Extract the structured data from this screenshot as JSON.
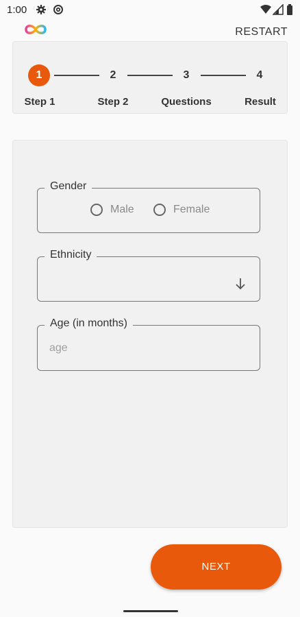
{
  "status_bar": {
    "time": "1:00"
  },
  "app_bar": {
    "restart_label": "RESTART"
  },
  "stepper": {
    "steps": [
      {
        "number": "1",
        "label": "Step 1",
        "active": true
      },
      {
        "number": "2",
        "label": "Step 2",
        "active": false
      },
      {
        "number": "3",
        "label": "Questions",
        "active": false
      },
      {
        "number": "4",
        "label": "Result",
        "active": false
      }
    ]
  },
  "form": {
    "gender": {
      "legend": "Gender",
      "options": [
        "Male",
        "Female"
      ]
    },
    "ethnicity": {
      "legend": "Ethnicity",
      "value": ""
    },
    "age": {
      "legend": "Age (in months)",
      "placeholder": "age"
    }
  },
  "actions": {
    "next_label": "NEXT"
  },
  "colors": {
    "accent": "#e8590c",
    "card": "#f1f1f1",
    "background": "#fafafa"
  },
  "icons": [
    "settings-icon",
    "at-sign-icon",
    "wifi-icon",
    "signal-icon",
    "battery-icon",
    "app-logo-icon",
    "arrow-down-icon"
  ]
}
